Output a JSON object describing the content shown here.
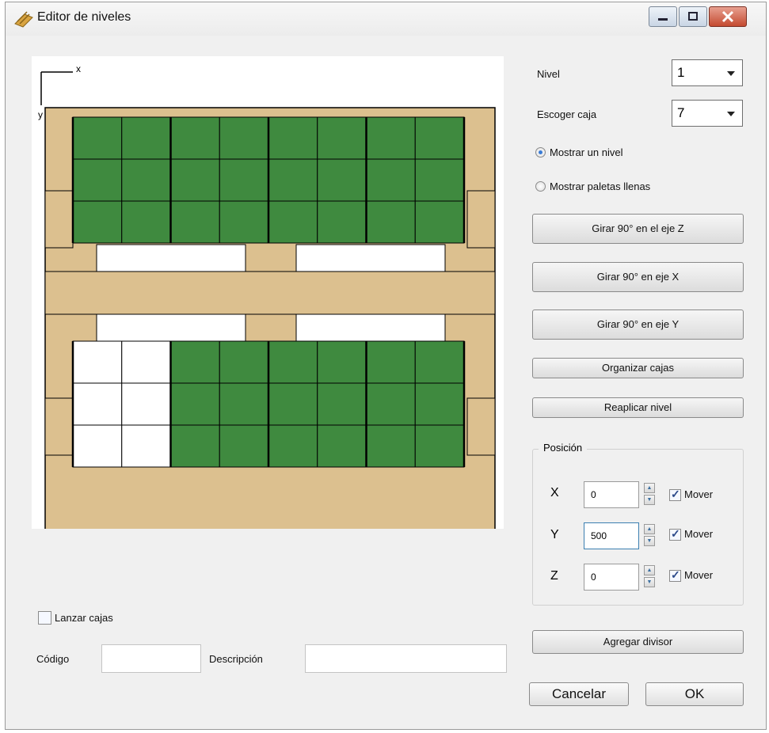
{
  "window": {
    "title": "Editor de niveles"
  },
  "canvas": {
    "axis_x": "x",
    "axis_y": "y",
    "pallet_color": "#dcc08f",
    "box_color": "#3f8a3f"
  },
  "controls": {
    "nivel_label": "Nivel",
    "nivel_value": "1",
    "caja_label": "Escoger caja",
    "caja_value": "7",
    "radio_show_level": "Mostrar un nivel",
    "radio_show_full": "Mostrar paletas llenas",
    "btn_rot_z": "Girar 90° en el eje Z",
    "btn_rot_x": "Girar 90° en eje X",
    "btn_rot_y": "Girar 90° en eje Y",
    "btn_organize": "Organizar cajas",
    "btn_reapply": "Reaplicar nivel",
    "btn_divider": "Agregar divisor"
  },
  "position": {
    "title": "Posición",
    "x_label": "X",
    "x_value": "0",
    "y_label": "Y",
    "y_value": "500",
    "z_label": "Z",
    "z_value": "0",
    "move_label": "Mover"
  },
  "bottom": {
    "launch_label": "Lanzar cajas",
    "code_label": "Código",
    "desc_label": "Descripción",
    "cancel_label": "Cancelar",
    "ok_label": "OK"
  }
}
